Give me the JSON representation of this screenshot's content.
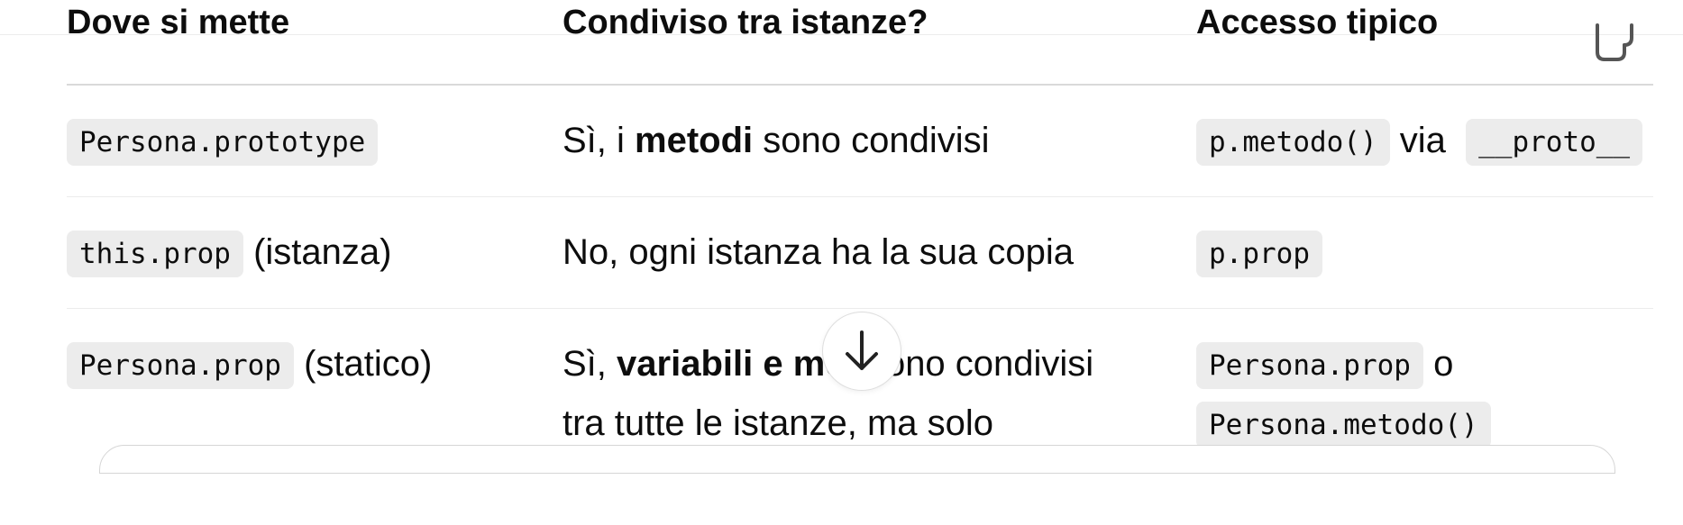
{
  "table": {
    "headers": [
      "Dove si mette",
      "Condiviso tra istanze?",
      "Accesso tipico"
    ],
    "rows": [
      {
        "c1_code": "Persona.prototype",
        "c2_pre": "Sì, i ",
        "c2_bold": "metodi",
        "c2_post": " sono condivisi",
        "c3_code1": "p.metodo()",
        "c3_mid": " via ",
        "c3_code2": "__proto__"
      },
      {
        "c1_code": "this.prop",
        "c1_suffix": " (istanza)",
        "c2_text": "No, ogni istanza ha la sua copia",
        "c3_code1": "p.prop"
      },
      {
        "c1_code": "Persona.prop",
        "c1_suffix": " (statico)",
        "c2_pre": "Sì, ",
        "c2_bold": "variabili e met",
        "c2_post": " sono condivisi",
        "c2_line2": "tra tutte le istanze, ma solo",
        "c3_code1": "Persona.prop",
        "c3_mid": " o",
        "c3_code2": "Persona.metodo()"
      }
    ]
  },
  "icons": {
    "copy": "copy-icon",
    "scroll_down": "arrow-down-icon"
  }
}
